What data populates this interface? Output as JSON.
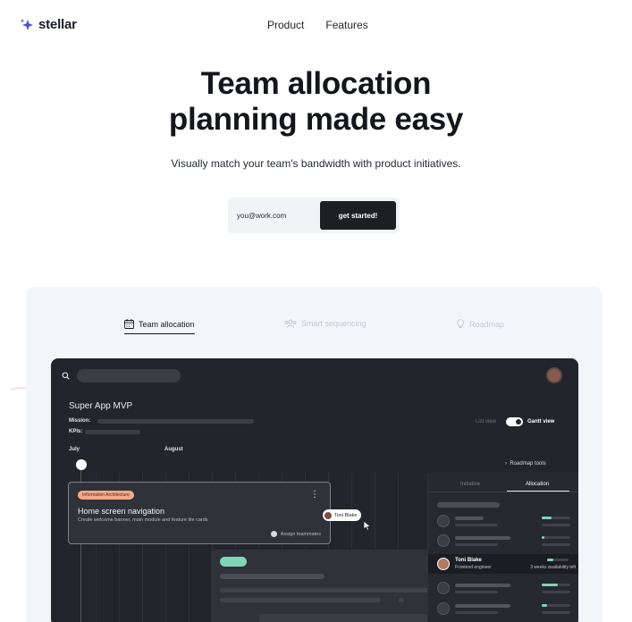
{
  "brand": {
    "name": "stellar",
    "accent": "#4a52d8"
  },
  "nav": {
    "items": [
      "Product",
      "Features"
    ]
  },
  "hero": {
    "title_line1": "Team allocation",
    "title_line2_pre": "planning made ",
    "title_highlight": "easy",
    "subtitle": "Visually match your team's bandwidth with product initiatives.",
    "email_placeholder": "you@work.com",
    "cta_label": "get started!",
    "highlight_color": "#f6dc85"
  },
  "showcase": {
    "tabs": [
      {
        "label": "Team allocation",
        "icon": "calendar-icon",
        "active": true
      },
      {
        "label": "Smart sequencing",
        "icon": "people-icon",
        "active": false
      },
      {
        "label": "Roadmap",
        "icon": "lightbulb-icon",
        "active": false
      }
    ],
    "app": {
      "project_title": "Super App MVP",
      "mission_label": "Mission:",
      "kpis_label": "KPIs:",
      "view_list": "List view",
      "view_gantt": "Gantt view",
      "months": [
        "July",
        "August"
      ],
      "roadmap_tools": "Roadmap tools",
      "task": {
        "tag": "Information Architecture",
        "title": "Home screen navigation",
        "description": "Create welcome banner, main module and feature tile cards",
        "assign_label": "Assign teammates",
        "tag_color": "#f4a989"
      },
      "drag_chip_name": "Toni Blake",
      "panel": {
        "tabs": [
          "Initiative",
          "Allocation"
        ],
        "active_tab": "Allocation",
        "highlighted_member": {
          "name": "Toni Blake",
          "role": "Frontend engineer",
          "availability": "3 weeks availability left"
        },
        "allocation_levels": [
          0.35,
          0.1,
          0.3,
          0.55,
          0.2
        ]
      },
      "accent_green": "#7fd6b4"
    }
  }
}
